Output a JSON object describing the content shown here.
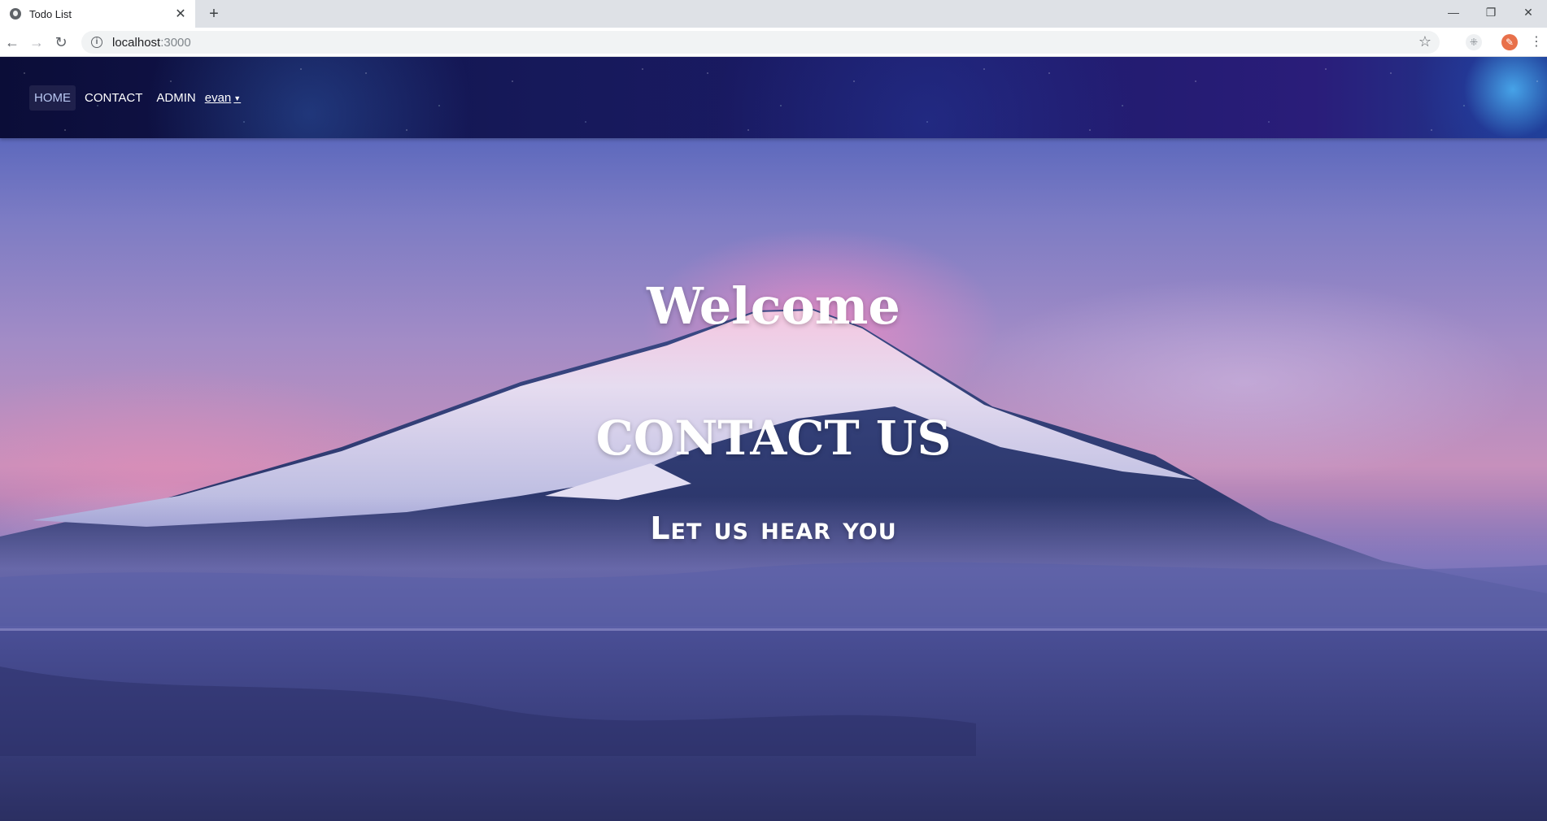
{
  "browser": {
    "tab_title": "Todo List",
    "tab_close": "✕",
    "new_tab": "+",
    "url_host": "localhost",
    "url_port": ":3000",
    "controls": {
      "minimize": "—",
      "restore": "❐",
      "close": "✕"
    }
  },
  "nav": {
    "items": [
      {
        "label": "HOME",
        "active": true
      },
      {
        "label": "CONTACT",
        "active": false
      },
      {
        "label": "ADMIN",
        "active": false
      }
    ],
    "user": "evan"
  },
  "hero": {
    "welcome": "Welcome",
    "title": "CONTACT US",
    "subtitle": "Let us hear you"
  }
}
